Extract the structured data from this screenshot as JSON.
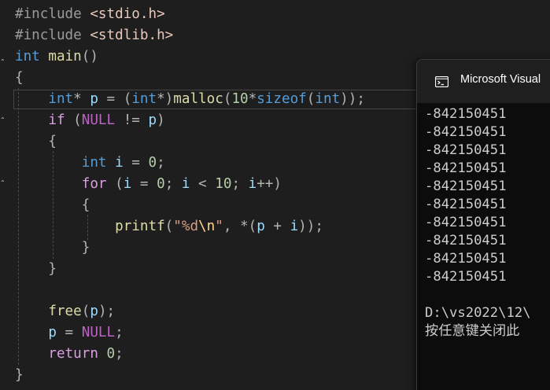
{
  "editor": {
    "lines": [
      [
        {
          "t": "#include ",
          "c": "tok-pre"
        },
        {
          "t": "<stdio.h>",
          "c": "tok-inc"
        }
      ],
      [
        {
          "t": "#include ",
          "c": "tok-pre"
        },
        {
          "t": "<stdlib.h>",
          "c": "tok-inc"
        }
      ],
      [
        {
          "t": "int",
          "c": "tok-kw"
        },
        {
          "t": " ",
          "c": ""
        },
        {
          "t": "main",
          "c": "tok-fn"
        },
        {
          "t": "()",
          "c": "tok-pun"
        }
      ],
      [
        {
          "t": "{",
          "c": "tok-pun"
        }
      ],
      [
        {
          "t": "    ",
          "c": ""
        },
        {
          "t": "int",
          "c": "tok-kw"
        },
        {
          "t": "* ",
          "c": "tok-pun"
        },
        {
          "t": "p",
          "c": "tok-var"
        },
        {
          "t": " = (",
          "c": "tok-pun"
        },
        {
          "t": "int",
          "c": "tok-kw"
        },
        {
          "t": "*)",
          "c": "tok-pun"
        },
        {
          "t": "malloc",
          "c": "tok-fn"
        },
        {
          "t": "(",
          "c": "tok-pun"
        },
        {
          "t": "10",
          "c": "tok-num"
        },
        {
          "t": "*",
          "c": "tok-pun"
        },
        {
          "t": "sizeof",
          "c": "tok-kw"
        },
        {
          "t": "(",
          "c": "tok-pun"
        },
        {
          "t": "int",
          "c": "tok-kw"
        },
        {
          "t": "));",
          "c": "tok-pun"
        }
      ],
      [
        {
          "t": "    ",
          "c": ""
        },
        {
          "t": "if",
          "c": "tok-ctrl"
        },
        {
          "t": " (",
          "c": "tok-pun"
        },
        {
          "t": "NULL",
          "c": "tok-mac"
        },
        {
          "t": " != ",
          "c": "tok-pun"
        },
        {
          "t": "p",
          "c": "tok-var"
        },
        {
          "t": ")",
          "c": "tok-pun"
        }
      ],
      [
        {
          "t": "    {",
          "c": "tok-pun"
        }
      ],
      [
        {
          "t": "        ",
          "c": ""
        },
        {
          "t": "int",
          "c": "tok-kw"
        },
        {
          "t": " ",
          "c": ""
        },
        {
          "t": "i",
          "c": "tok-var"
        },
        {
          "t": " = ",
          "c": "tok-pun"
        },
        {
          "t": "0",
          "c": "tok-num"
        },
        {
          "t": ";",
          "c": "tok-pun"
        }
      ],
      [
        {
          "t": "        ",
          "c": ""
        },
        {
          "t": "for",
          "c": "tok-ctrl"
        },
        {
          "t": " (",
          "c": "tok-pun"
        },
        {
          "t": "i",
          "c": "tok-var"
        },
        {
          "t": " = ",
          "c": "tok-pun"
        },
        {
          "t": "0",
          "c": "tok-num"
        },
        {
          "t": "; ",
          "c": "tok-pun"
        },
        {
          "t": "i",
          "c": "tok-var"
        },
        {
          "t": " < ",
          "c": "tok-pun"
        },
        {
          "t": "10",
          "c": "tok-num"
        },
        {
          "t": "; ",
          "c": "tok-pun"
        },
        {
          "t": "i",
          "c": "tok-var"
        },
        {
          "t": "++)",
          "c": "tok-pun"
        }
      ],
      [
        {
          "t": "        {",
          "c": "tok-pun"
        }
      ],
      [
        {
          "t": "            ",
          "c": ""
        },
        {
          "t": "printf",
          "c": "tok-fn"
        },
        {
          "t": "(",
          "c": "tok-pun"
        },
        {
          "t": "\"%d",
          "c": "tok-str"
        },
        {
          "t": "\\n",
          "c": "tok-esc"
        },
        {
          "t": "\"",
          "c": "tok-str"
        },
        {
          "t": ", *(",
          "c": "tok-pun"
        },
        {
          "t": "p",
          "c": "tok-var"
        },
        {
          "t": " + ",
          "c": "tok-pun"
        },
        {
          "t": "i",
          "c": "tok-var"
        },
        {
          "t": "));",
          "c": "tok-pun"
        }
      ],
      [
        {
          "t": "        }",
          "c": "tok-pun"
        }
      ],
      [
        {
          "t": "    }",
          "c": "tok-pun"
        }
      ],
      [],
      [
        {
          "t": "    ",
          "c": ""
        },
        {
          "t": "free",
          "c": "tok-fn"
        },
        {
          "t": "(",
          "c": "tok-pun"
        },
        {
          "t": "p",
          "c": "tok-var"
        },
        {
          "t": ");",
          "c": "tok-pun"
        }
      ],
      [
        {
          "t": "    ",
          "c": ""
        },
        {
          "t": "p",
          "c": "tok-var"
        },
        {
          "t": " = ",
          "c": "tok-pun"
        },
        {
          "t": "NULL",
          "c": "tok-mac"
        },
        {
          "t": ";",
          "c": "tok-pun"
        }
      ],
      [
        {
          "t": "    ",
          "c": ""
        },
        {
          "t": "return",
          "c": "tok-ctrl"
        },
        {
          "t": " ",
          "c": ""
        },
        {
          "t": "0",
          "c": "tok-num"
        },
        {
          "t": ";",
          "c": "tok-pun"
        }
      ],
      [
        {
          "t": "}",
          "c": "tok-pun"
        }
      ]
    ]
  },
  "console": {
    "title": "Microsoft Visual",
    "output": [
      "-842150451",
      "-842150451",
      "-842150451",
      "-842150451",
      "-842150451",
      "-842150451",
      "-842150451",
      "-842150451",
      "-842150451",
      "-842150451",
      "",
      "D:\\vs2022\\12\\",
      "按任意键关闭此"
    ]
  },
  "colors": {
    "editor_bg": "#1e1e1e",
    "console_bg": "#0c0c0c",
    "keyword": "#569cd6",
    "control": "#d8a0df",
    "function": "#dcdcaa",
    "number": "#b5cea8",
    "variable": "#9cdcfe",
    "string": "#d69d85",
    "macro": "#bd63c5"
  }
}
